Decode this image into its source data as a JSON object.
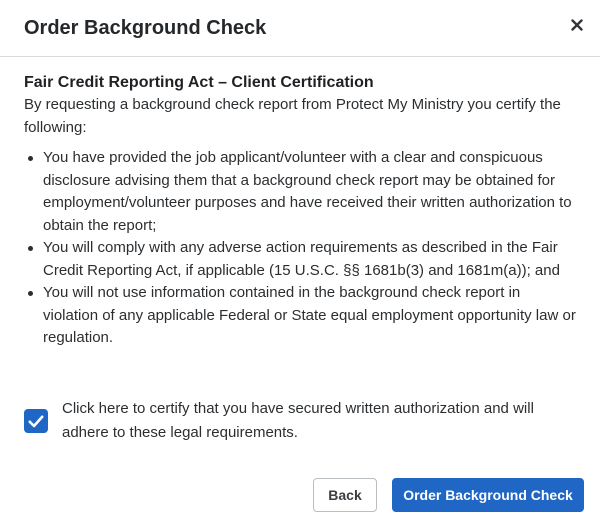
{
  "header": {
    "title": "Order Background Check",
    "close_icon": "close-icon"
  },
  "body": {
    "heading": "Fair Credit Reporting Act – Client Certification",
    "intro": "By requesting a background check report from Protect My Ministry you certify the following:",
    "items": [
      "You have provided the job applicant/volunteer with a clear and conspicuous disclosure advising them that a background check report may be obtained for employment/volunteer purposes and have received their written authorization to obtain the report;",
      "You will comply with any adverse action requirements as described in the Fair Credit Reporting Act, if applicable (15 U.S.C. §§ 1681b(3) and 1681m(a)); and",
      "You will not use information contained in the background check report in violation of any applicable Federal or State equal employment opportunity law or regulation."
    ]
  },
  "certify": {
    "checked": true,
    "label": "Click here to certify that you have secured written authorization and will adhere to these legal requirements."
  },
  "footer": {
    "back_label": "Back",
    "order_label": "Order Background Check"
  },
  "colors": {
    "primary": "#1f66c5",
    "border": "#d9dcdf",
    "text": "#2b2e31"
  }
}
